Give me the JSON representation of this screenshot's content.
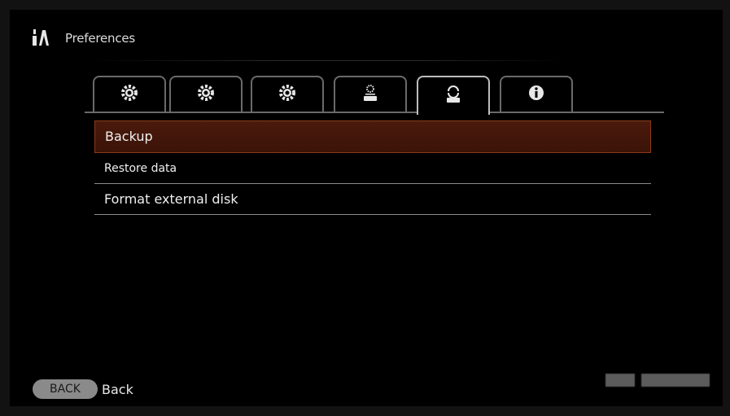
{
  "header": {
    "title": "Preferences",
    "icon": "tools-icon"
  },
  "tabs": [
    {
      "icon": "gear-icon",
      "active": false
    },
    {
      "icon": "gear-2-icon",
      "active": false
    },
    {
      "icon": "gear-3-icon",
      "active": false
    },
    {
      "icon": "drive-settings-icon",
      "active": false
    },
    {
      "icon": "drive-refresh-icon",
      "active": true
    },
    {
      "icon": "info-icon",
      "active": false
    }
  ],
  "menu": {
    "items": [
      {
        "label": "Backup",
        "selected": true
      },
      {
        "label": "Restore data",
        "selected": false
      },
      {
        "label": "Format external disk",
        "selected": false
      }
    ]
  },
  "footer": {
    "back_key": "BACK",
    "back_label": "Back"
  },
  "colors": {
    "selected_bg": "#4a1a0c",
    "selected_border": "#8a3a1a",
    "tab_border": "#6a6a6a"
  }
}
